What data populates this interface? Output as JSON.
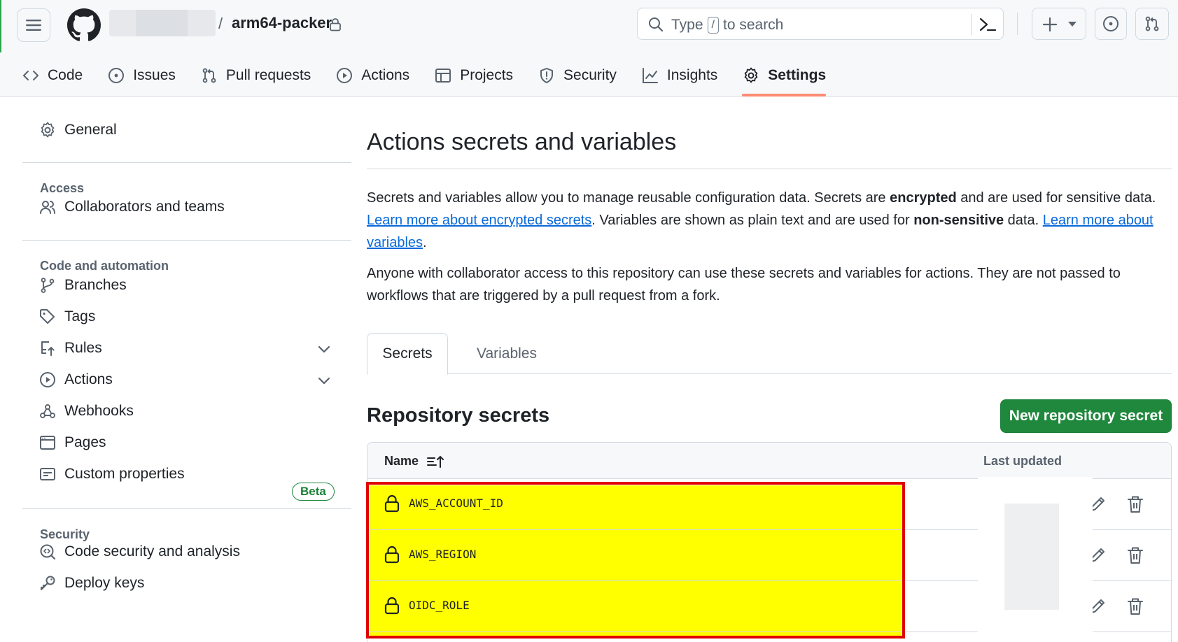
{
  "header": {
    "repo_name": "arm64-packer",
    "separator": "/",
    "search": {
      "prefix": "Type",
      "key": "/",
      "suffix": "to search"
    },
    "icons": [
      "hamburger-icon",
      "github-logo",
      "lock-icon",
      "search-icon",
      "command-palette-icon",
      "plus-icon",
      "triangle-down-icon",
      "issue-opened-icon",
      "git-pull-request-icon"
    ]
  },
  "repo_nav": {
    "items": [
      {
        "label": "Code",
        "icon": "code-icon"
      },
      {
        "label": "Issues",
        "icon": "issue-opened-icon"
      },
      {
        "label": "Pull requests",
        "icon": "git-pull-request-icon"
      },
      {
        "label": "Actions",
        "icon": "play-icon"
      },
      {
        "label": "Projects",
        "icon": "table-icon"
      },
      {
        "label": "Security",
        "icon": "shield-icon"
      },
      {
        "label": "Insights",
        "icon": "graph-icon"
      },
      {
        "label": "Settings",
        "icon": "gear-icon",
        "active": true
      }
    ]
  },
  "sidebar": {
    "general": "General",
    "access_heading": "Access",
    "collaborators": "Collaborators and teams",
    "code_automation_heading": "Code and automation",
    "branches": "Branches",
    "tags": "Tags",
    "rules": "Rules",
    "actions": "Actions",
    "webhooks": "Webhooks",
    "pages": "Pages",
    "custom_properties": "Custom properties",
    "beta_badge": "Beta",
    "security_heading": "Security",
    "code_security": "Code security and analysis",
    "deploy_keys": "Deploy keys"
  },
  "main": {
    "title": "Actions secrets and variables",
    "desc1": {
      "part1": "Secrets and variables allow you to manage reusable configuration data. Secrets are ",
      "bold1": "encrypted",
      "part2": " and are used for sensitive data. ",
      "link1": "Learn more about encrypted secrets",
      "part3": ". Variables are shown as plain text and are used for ",
      "bold2": "non-sensitive",
      "part4": " data. ",
      "link2": "Learn more about variables",
      "part5": "."
    },
    "desc2": "Anyone with collaborator access to this repository can use these secrets and variables for actions. They are not passed to workflows that are triggered by a pull request from a fork.",
    "tabs": {
      "secrets": "Secrets",
      "variables": "Variables"
    },
    "section_title": "Repository secrets",
    "new_secret_button": "New repository secret",
    "table": {
      "col_name": "Name",
      "col_updated": "Last updated",
      "rows": [
        {
          "name": "AWS_ACCOUNT_ID"
        },
        {
          "name": "AWS_REGION"
        },
        {
          "name": "OIDC_ROLE"
        }
      ]
    }
  },
  "colors": {
    "accent_green": "#1f883d",
    "link_blue": "#0969da",
    "highlight_yellow": "#ffff00",
    "highlight_border": "#e00000",
    "active_tab_underline": "#fd8c73"
  }
}
